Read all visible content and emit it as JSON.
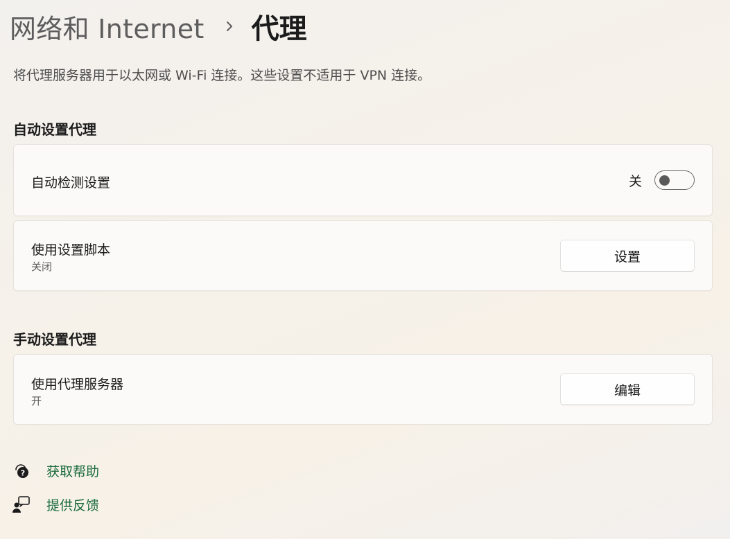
{
  "breadcrumb": {
    "parent": "网络和 Internet",
    "current": "代理",
    "separator_icon": "chevron-right-icon"
  },
  "description": "将代理服务器用于以太网或 Wi-Fi 连接。这些设置不适用于 VPN 连接。",
  "auto_section": {
    "title": "自动设置代理",
    "detect": {
      "label": "自动检测设置",
      "toggle_state_text": "关",
      "enabled": false
    },
    "script": {
      "label": "使用设置脚本",
      "status": "关闭",
      "button_label": "设置"
    }
  },
  "manual_section": {
    "title": "手动设置代理",
    "proxy_server": {
      "label": "使用代理服务器",
      "status": "开",
      "button_label": "编辑"
    }
  },
  "links": {
    "help": {
      "label": "获取帮助",
      "icon": "help-chat-icon"
    },
    "feedback": {
      "label": "提供反馈",
      "icon": "feedback-person-icon"
    }
  },
  "colors": {
    "link": "#1a6b3c",
    "card_bg": "#fcfbf9",
    "text_primary": "#1b1b1b",
    "text_secondary": "#5f5f5f"
  }
}
